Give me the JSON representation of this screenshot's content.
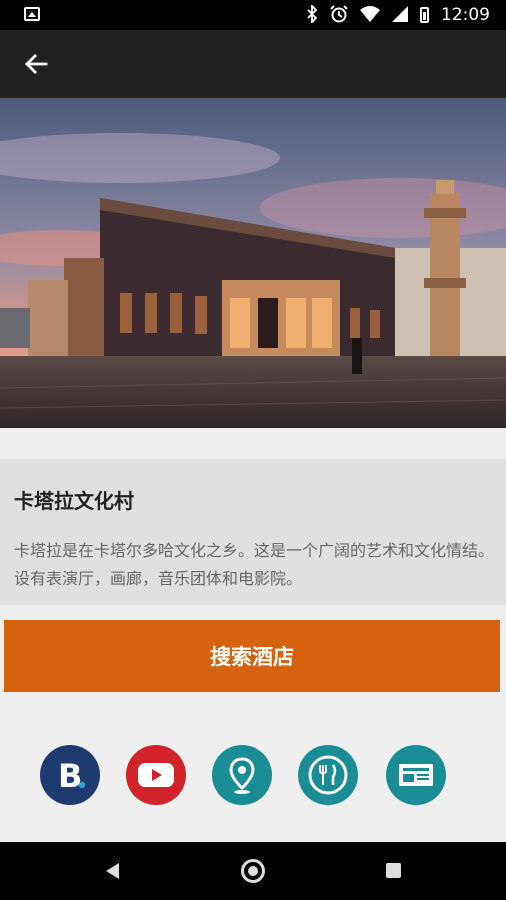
{
  "status_bar": {
    "time": "12:09",
    "icons": [
      "image-icon",
      "bluetooth-icon",
      "alarm-icon",
      "wifi-icon",
      "signal-icon",
      "battery-icon"
    ]
  },
  "app_bar": {
    "back_icon": "arrow-back-icon"
  },
  "place": {
    "title": "卡塔拉文化村",
    "description": "卡塔拉是在卡塔尔多哈文化之乡。这是一个广阔的艺术和文化情结。设有表演厅，画廊，音乐团体和电影院。"
  },
  "search_button": {
    "label": "搜索酒店",
    "color": "#d4620f"
  },
  "quick_icons": [
    {
      "name": "booking-icon",
      "color": "#1f3a6e"
    },
    {
      "name": "youtube-icon",
      "color": "#d2232a"
    },
    {
      "name": "map-pin-icon",
      "color": "#1a8c96"
    },
    {
      "name": "restaurant-icon",
      "color": "#1a8c96"
    },
    {
      "name": "news-icon",
      "color": "#1a8c96"
    }
  ],
  "nav_bar": {
    "icons": [
      "nav-back-icon",
      "nav-home-icon",
      "nav-recent-icon"
    ]
  }
}
